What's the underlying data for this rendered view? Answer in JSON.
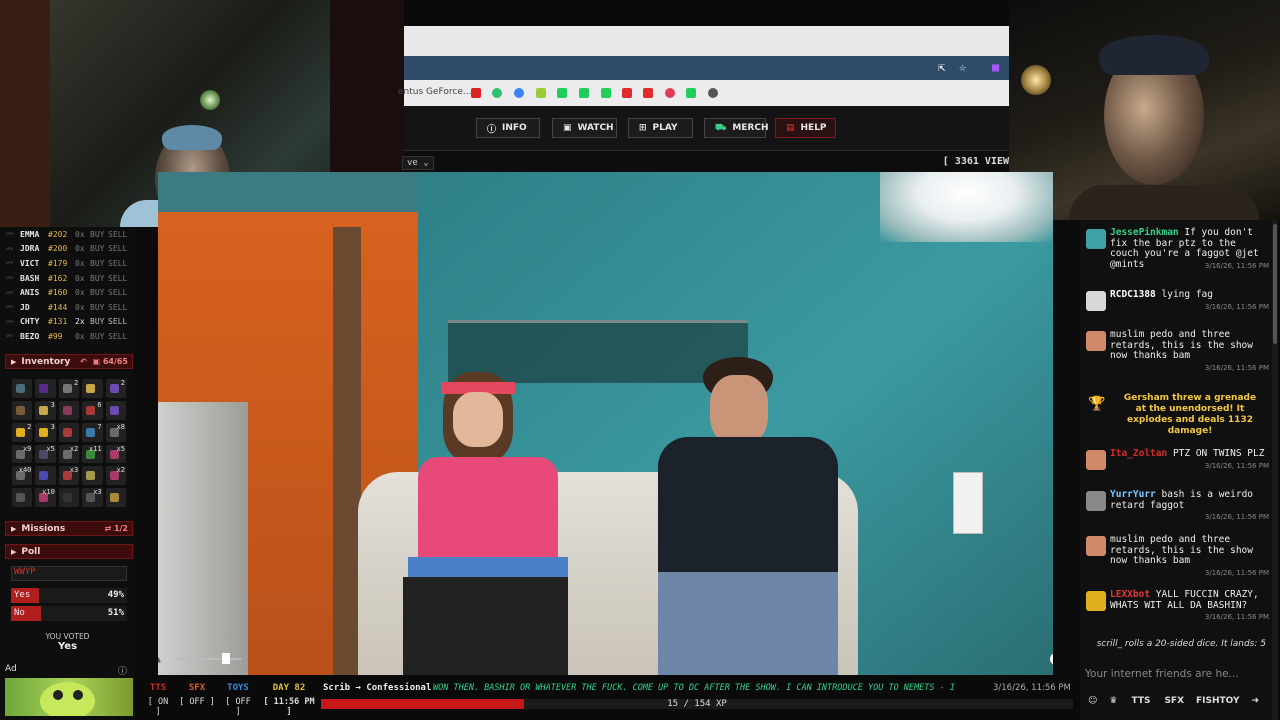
{
  "browser": {
    "bookmark_text": "entus GeForce...",
    "nav_buttons": [
      {
        "label": "INFO",
        "icon": "info-icon"
      },
      {
        "label": "WATCH",
        "icon": "camera-icon"
      },
      {
        "label": "PLAY",
        "icon": "grid-icon"
      },
      {
        "label": "MERCH",
        "icon": "cart-icon"
      },
      {
        "label": "HELP",
        "icon": "chat-icon"
      }
    ],
    "dropdown": "ve",
    "views": "[ 3361 VIEW"
  },
  "stocks": [
    {
      "name": "EMMA",
      "price": "#202",
      "mult": "0x",
      "buy": "BUY",
      "sell": "SELL"
    },
    {
      "name": "JDRA",
      "price": "#200",
      "mult": "0x",
      "buy": "BUY",
      "sell": "SELL"
    },
    {
      "name": "VICT",
      "price": "#179",
      "mult": "0x",
      "buy": "BUY",
      "sell": "SELL"
    },
    {
      "name": "BASH",
      "price": "#162",
      "mult": "0x",
      "buy": "BUY",
      "sell": "SELL"
    },
    {
      "name": "ANIS",
      "price": "#160",
      "mult": "0x",
      "buy": "BUY",
      "sell": "SELL"
    },
    {
      "name": "JD",
      "price": "#144",
      "mult": "0x",
      "buy": "BUY",
      "sell": "SELL"
    },
    {
      "name": "CHTY",
      "price": "#131",
      "mult": "2x",
      "buy": "BUY",
      "sell": "SELL"
    },
    {
      "name": "BEZO",
      "price": "#99",
      "mult": "0x",
      "buy": "BUY",
      "sell": "SELL"
    }
  ],
  "inventory": {
    "title": "Inventory",
    "count": "64/65",
    "counts": [
      "",
      "",
      "2",
      "",
      "2",
      "",
      "3",
      "",
      "6",
      "",
      "2",
      "3",
      "",
      "7",
      "x8",
      "x9",
      "x5",
      "x2",
      "x11",
      "x5",
      "x40",
      "",
      "x3",
      "",
      "x2",
      "",
      "x10",
      "",
      "x3",
      ""
    ]
  },
  "missions": {
    "title": "Missions",
    "count": "1/2"
  },
  "poll": {
    "title": "Poll",
    "question": "WWYP",
    "options": [
      {
        "label": "Yes",
        "percent": "49%",
        "fill": 0.49
      },
      {
        "label": "No",
        "percent": "51%",
        "fill": 0.51
      }
    ],
    "voted_label": "YOU VOTED",
    "voted_value": "Yes"
  },
  "ad": {
    "label": "Ad"
  },
  "chat": {
    "messages": [
      {
        "user": "JessePinkman",
        "user_color": "#35d08a",
        "text": "If you don't fix the bar ptz to the couch you're a faggot @jet @mints",
        "ts": "3/16/26, 11:56 PM"
      },
      {
        "user": "RCDC1388",
        "user_color": "#ffffff",
        "text": "lying fag",
        "ts": "3/16/26, 11:56 PM"
      },
      {
        "user": "",
        "user_color": "#2b3fd6",
        "text": "muslim pedo and three retards, this is the show now thanks bam",
        "ts": "3/16/26, 11:56 PM"
      },
      {
        "user": "Ita_Zoltan",
        "user_color": "#d12b2b",
        "text": "PTZ ON TWINS PLZ",
        "ts": "3/16/26, 11:56 PM"
      },
      {
        "user": "YurrYurr",
        "user_color": "#7ec8ff",
        "text": "bash is a weirdo retard faggot",
        "ts": "3/16/26, 11:56 PM"
      },
      {
        "user": "",
        "user_color": "#2b3fd6",
        "text": "muslim pedo and three retards, this is the show now thanks bam",
        "ts": "3/16/26, 11:56 PM"
      },
      {
        "user": "LEXXbot",
        "user_color": "#e03a3a",
        "text": "YALL FUCCIN CRAZY, WHATS WIT ALL DA BASHIN?",
        "ts": "3/16/26, 11:56 PM"
      }
    ],
    "event": "Gersham threw a grenade at the unendorsed! It explodes and deals 1132 damage!",
    "dice": "scrill_ rolls a 20-sided dice. It lands: 5",
    "input_placeholder": "Your internet friends are he...",
    "tools": [
      "TTS",
      "SFX",
      "FISHTOY"
    ]
  },
  "bottom": {
    "toggles": [
      {
        "name": "TTS",
        "state": "[ ON ]",
        "color": "#d12b2b"
      },
      {
        "name": "SFX",
        "state": "[ OFF ]",
        "color": "#e05a2a"
      },
      {
        "name": "TOYS",
        "state": "[ OFF ]",
        "color": "#3a8be0"
      },
      {
        "name": "DAY 82",
        "state": "[ 11:56 PM ]",
        "color": "#e0c040"
      }
    ],
    "now_playing": "Scrib → Confessional",
    "ticker": "WON THEN. BASHIR OR WHATEVER THE FUCK. COME UP TO DC AFTER THE SHOW. I CAN INTRODUCE YOU TO NEMETS - I",
    "ticker_ts": "3/16/26, 11:56 PM",
    "xp_text": "15 / 154 XP",
    "xp_fill": 0.097
  }
}
